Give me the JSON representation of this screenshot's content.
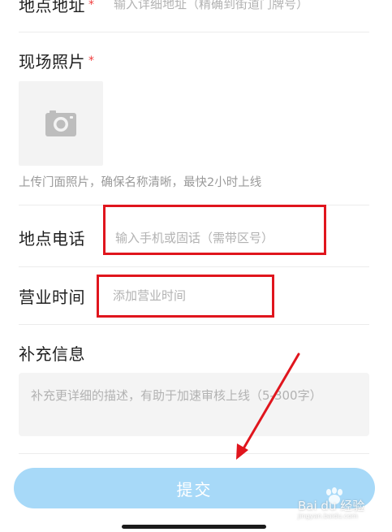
{
  "address": {
    "label": "地点地址",
    "required_mark": "*",
    "placeholder": "输入详细地址（精确到街道门牌号）"
  },
  "photo": {
    "label": "现场照片",
    "required_mark": "*",
    "icon": "camera-icon",
    "hint": "上传门面照片，确保名称清晰，最快2小时上线"
  },
  "phone": {
    "label": "地点电话",
    "placeholder": "输入手机或固话（需带区号）"
  },
  "hours": {
    "label": "营业时间",
    "placeholder": "添加营业时间"
  },
  "extra": {
    "label": "补充信息",
    "placeholder": "补充更详细的描述，有助于加速审核上线（5-300字）"
  },
  "submit": {
    "label": "提交"
  },
  "watermark": {
    "brand": "Bai du 经验",
    "url": "jingyan.baidu.com"
  },
  "colors": {
    "annotation": "#e0151d",
    "submit_bg": "#a7d9f8",
    "required": "#f03c3c"
  }
}
